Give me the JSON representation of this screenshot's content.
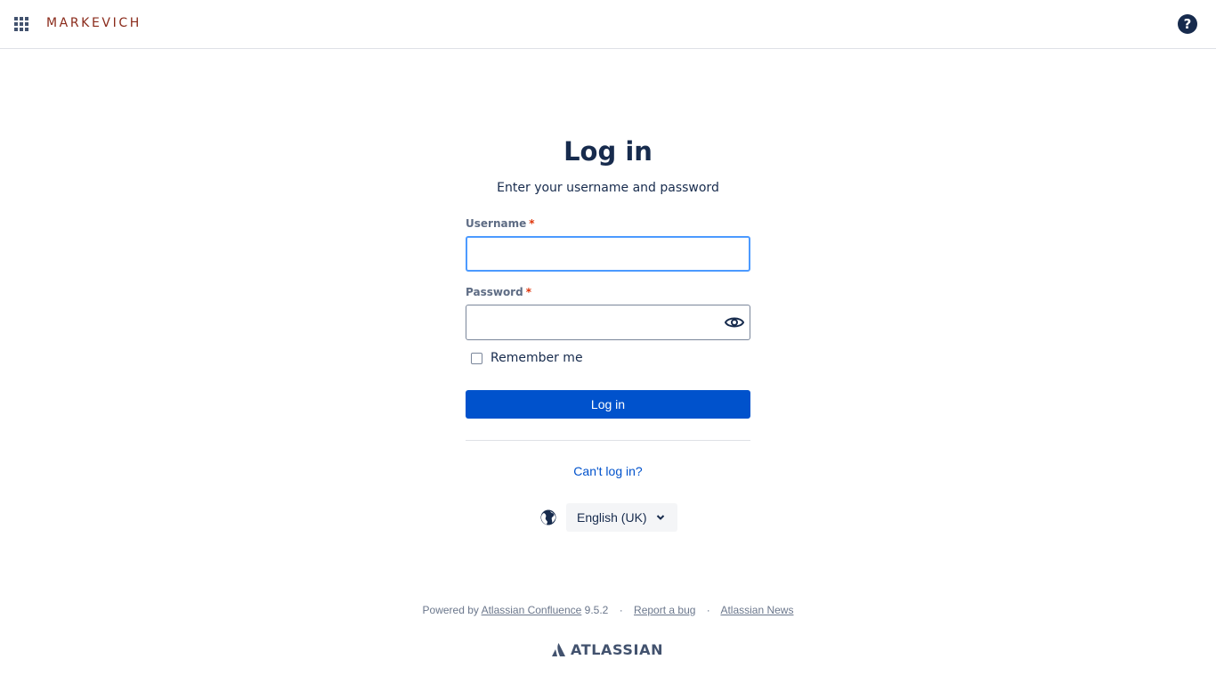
{
  "header": {
    "logo_text": "MARKEVICH",
    "help_icon": "question-circle-icon",
    "help_glyph": "?",
    "app_switcher_icon": "grid-icon"
  },
  "login": {
    "title": "Log in",
    "subtitle": "Enter your username and password",
    "username_label": "Username",
    "password_label": "Password",
    "required_mark": "*",
    "username_value": "",
    "password_value": "",
    "remember_label": "Remember me",
    "remember_checked": false,
    "submit_label": "Log in",
    "cant_login_label": "Can't log in?"
  },
  "language": {
    "icon": "globe-icon",
    "selected": "English (UK)"
  },
  "footer": {
    "powered_by": "Powered by",
    "product_link": "Atlassian Confluence",
    "version": "9.5.2",
    "separator": "·",
    "report_bug": "Report a bug",
    "news": "Atlassian News",
    "brand": "ATLASSIAN"
  },
  "colors": {
    "primary": "#0052cc",
    "text": "#172b4d",
    "logo": "#8a2a1a",
    "required": "#de350b",
    "focus_border": "#4c9aff"
  }
}
